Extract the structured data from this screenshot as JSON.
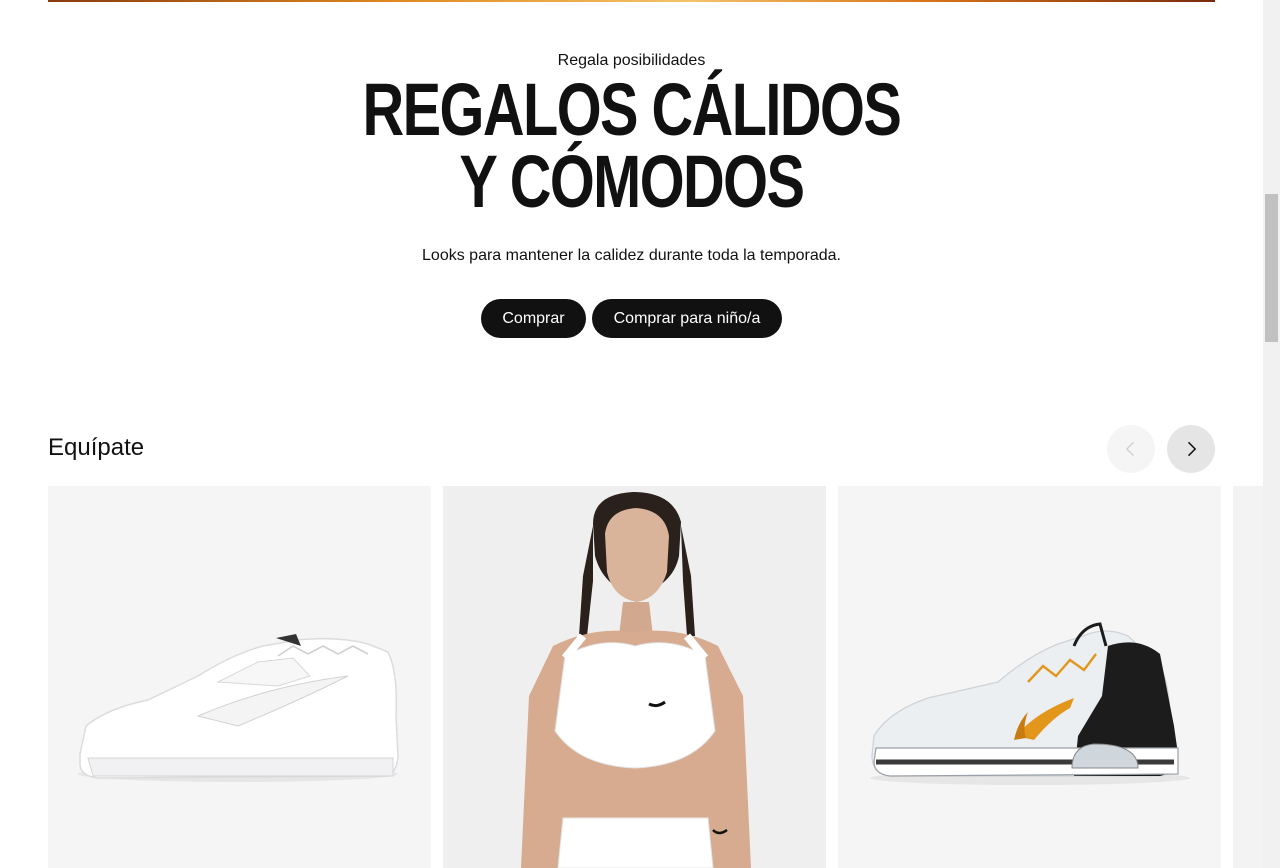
{
  "hero": {
    "eyebrow": "Regala posibilidades",
    "headline_line1": "REGALOS CÁLIDOS",
    "headline_line2": "Y CÓMODOS",
    "subtitle": "Looks para mantener la calidez durante toda la temporada.",
    "cta_primary": "Comprar",
    "cta_secondary": "Comprar para niño/a"
  },
  "section": {
    "title": "Equípate",
    "prev_icon": "chevron-left-icon",
    "next_icon": "chevron-right-icon"
  },
  "products": [
    {
      "image": "white-sneaker-image"
    },
    {
      "image": "sports-bra-model-image"
    },
    {
      "image": "training-shoe-image"
    },
    {
      "image": "partial-product-image"
    }
  ],
  "colors": {
    "accent_dark": "#111111",
    "card_bg": "#f5f5f5",
    "swoosh_orange": "#e3961c"
  }
}
